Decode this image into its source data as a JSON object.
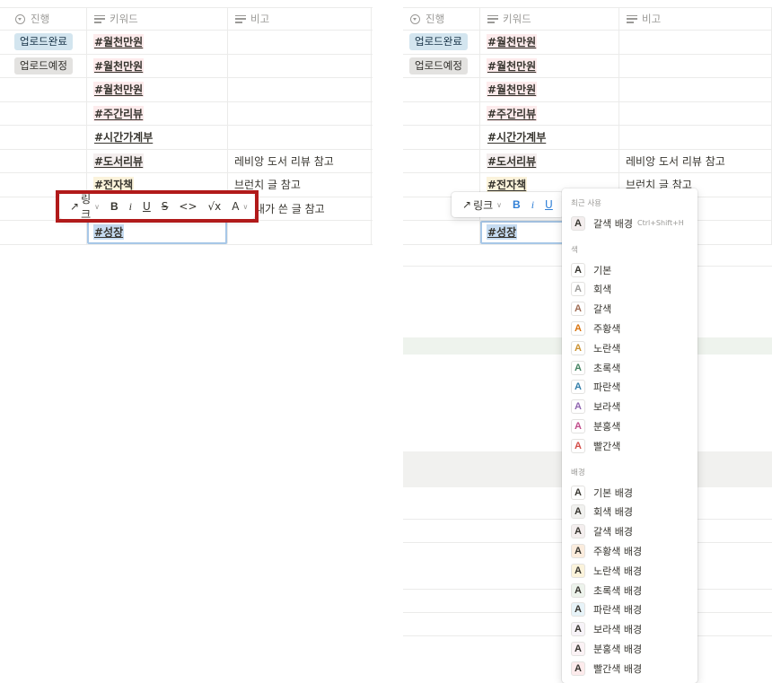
{
  "columns": {
    "status": "진행",
    "keyword": "키워드",
    "note": "비고"
  },
  "rows": [
    {
      "status": "업로드완료",
      "keyword": "#월천만원",
      "note": ""
    },
    {
      "status": "업로드예정",
      "keyword": "#월천만원",
      "note": ""
    },
    {
      "status": "",
      "keyword": "#월천만원",
      "note": ""
    },
    {
      "status": "",
      "keyword": "#주간리뷰",
      "note": ""
    },
    {
      "status": "",
      "keyword": "#시간가계부",
      "note": ""
    },
    {
      "status": "",
      "keyword": "#도서리뷰",
      "note": "레비앙 도서 리뷰 참고"
    },
    {
      "status": "",
      "keyword": "#전자책",
      "note": "브런치 글 참고"
    },
    {
      "status": "",
      "keyword": "",
      "note": "내가 쓴 글 참고"
    },
    {
      "status": "",
      "keyword": "#성장",
      "note": ""
    }
  ],
  "toolbar": {
    "link_label": "링크",
    "bold": "B",
    "italic": "i",
    "underline": "U",
    "strike": "S",
    "code": "<>",
    "equation": "√x",
    "color": "A"
  },
  "color_menu": {
    "recent_label": "최근 사용",
    "recent_item": "갈색 배경",
    "recent_shortcut": "Ctrl+Shift+H",
    "text_label": "색",
    "text_colors": [
      {
        "label": "기본",
        "color": "#37352f"
      },
      {
        "label": "회색",
        "color": "#9b9a97"
      },
      {
        "label": "갈색",
        "color": "#9f6b53"
      },
      {
        "label": "주황색",
        "color": "#d9730d"
      },
      {
        "label": "노란색",
        "color": "#cb912f"
      },
      {
        "label": "초록색",
        "color": "#448361"
      },
      {
        "label": "파란색",
        "color": "#337ea9"
      },
      {
        "label": "보라색",
        "color": "#9065b0"
      },
      {
        "label": "분홍색",
        "color": "#c14c8a"
      },
      {
        "label": "빨간색",
        "color": "#d44c47"
      }
    ],
    "bg_label": "배경",
    "bg_colors": [
      {
        "label": "기본 배경",
        "color": "#ffffff"
      },
      {
        "label": "회색 배경",
        "color": "#f1f1ef"
      },
      {
        "label": "갈색 배경",
        "color": "#f4eeee"
      },
      {
        "label": "주황색 배경",
        "color": "#fbecdd"
      },
      {
        "label": "노란색 배경",
        "color": "#fbf3db"
      },
      {
        "label": "초록색 배경",
        "color": "#edf3ec"
      },
      {
        "label": "파란색 배경",
        "color": "#e7f3f8"
      },
      {
        "label": "보라색 배경",
        "color": "#f7f3f8"
      },
      {
        "label": "분홍색 배경",
        "color": "#fbf2f5"
      },
      {
        "label": "빨간색 배경",
        "color": "#fdebec"
      }
    ]
  },
  "colors": {
    "highlight_border": "#b11a1a",
    "tag_done_bg": "#d3e5ef",
    "tag_planned_bg": "#e3e2e0",
    "edit_outline": "#a7c7e7"
  }
}
